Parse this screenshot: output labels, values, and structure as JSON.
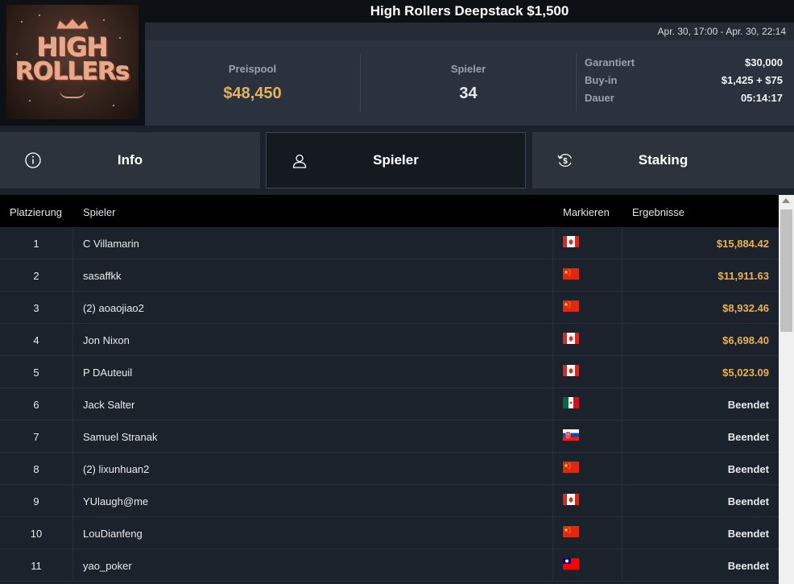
{
  "header": {
    "title": "High Rollers Deepstack $1,500",
    "dates": "Apr. 30, 17:00 - Apr. 30, 22:14",
    "logo": {
      "line1": "HIGH",
      "line2": "ROLLERs"
    }
  },
  "stats": {
    "pool_label": "Preispool",
    "pool_value": "$48,450",
    "players_label": "Spieler",
    "players_value": "34",
    "details": [
      {
        "key": "Garantiert",
        "value": "$30,000"
      },
      {
        "key": "Buy-in",
        "value": "$1,425 + $75"
      },
      {
        "key": "Dauer",
        "value": "05:14:17"
      }
    ]
  },
  "tabs": [
    {
      "label": "Info",
      "icon": "info-icon"
    },
    {
      "label": "Spieler",
      "icon": "user-icon",
      "active": true
    },
    {
      "label": "Staking",
      "icon": "dollar-refresh-icon"
    }
  ],
  "table": {
    "columns": [
      "Platzierung",
      "Spieler",
      "Markieren",
      "Ergebnisse"
    ],
    "rows": [
      {
        "place": "1",
        "name": "C Villamarin",
        "flag": "canada-flag-icon",
        "result": "$15,884.42",
        "money": true
      },
      {
        "place": "2",
        "name": "sasaffkk",
        "flag": "china-flag-icon",
        "result": "$11,911.63",
        "money": true
      },
      {
        "place": "3",
        "name": "(2) aoaojiao2",
        "flag": "china-flag-icon",
        "result": "$8,932.46",
        "money": true
      },
      {
        "place": "4",
        "name": "Jon Nixon",
        "flag": "canada-flag-icon",
        "result": "$6,698.40",
        "money": true
      },
      {
        "place": "5",
        "name": "P DAuteuil",
        "flag": "canada-flag-icon",
        "result": "$5,023.09",
        "money": true
      },
      {
        "place": "6",
        "name": "Jack Salter",
        "flag": "mexico-flag-icon",
        "result": "Beendet",
        "money": false
      },
      {
        "place": "7",
        "name": "Samuel Stranak",
        "flag": "slovakia-flag-icon",
        "result": "Beendet",
        "money": false
      },
      {
        "place": "8",
        "name": "(2) lixunhuan2",
        "flag": "china-flag-icon",
        "result": "Beendet",
        "money": false
      },
      {
        "place": "9",
        "name": "YUlaugh@me",
        "flag": "canada-flag-icon",
        "result": "Beendet",
        "money": false
      },
      {
        "place": "10",
        "name": "LouDianfeng",
        "flag": "china-flag-icon",
        "result": "Beendet",
        "money": false
      },
      {
        "place": "11",
        "name": "yao_poker",
        "flag": "taiwan-flag-icon",
        "result": "Beendet",
        "money": false
      }
    ]
  },
  "colors": {
    "accent_gold": "#e7b15a",
    "background": "#1c222b",
    "header_black": "#000000"
  }
}
